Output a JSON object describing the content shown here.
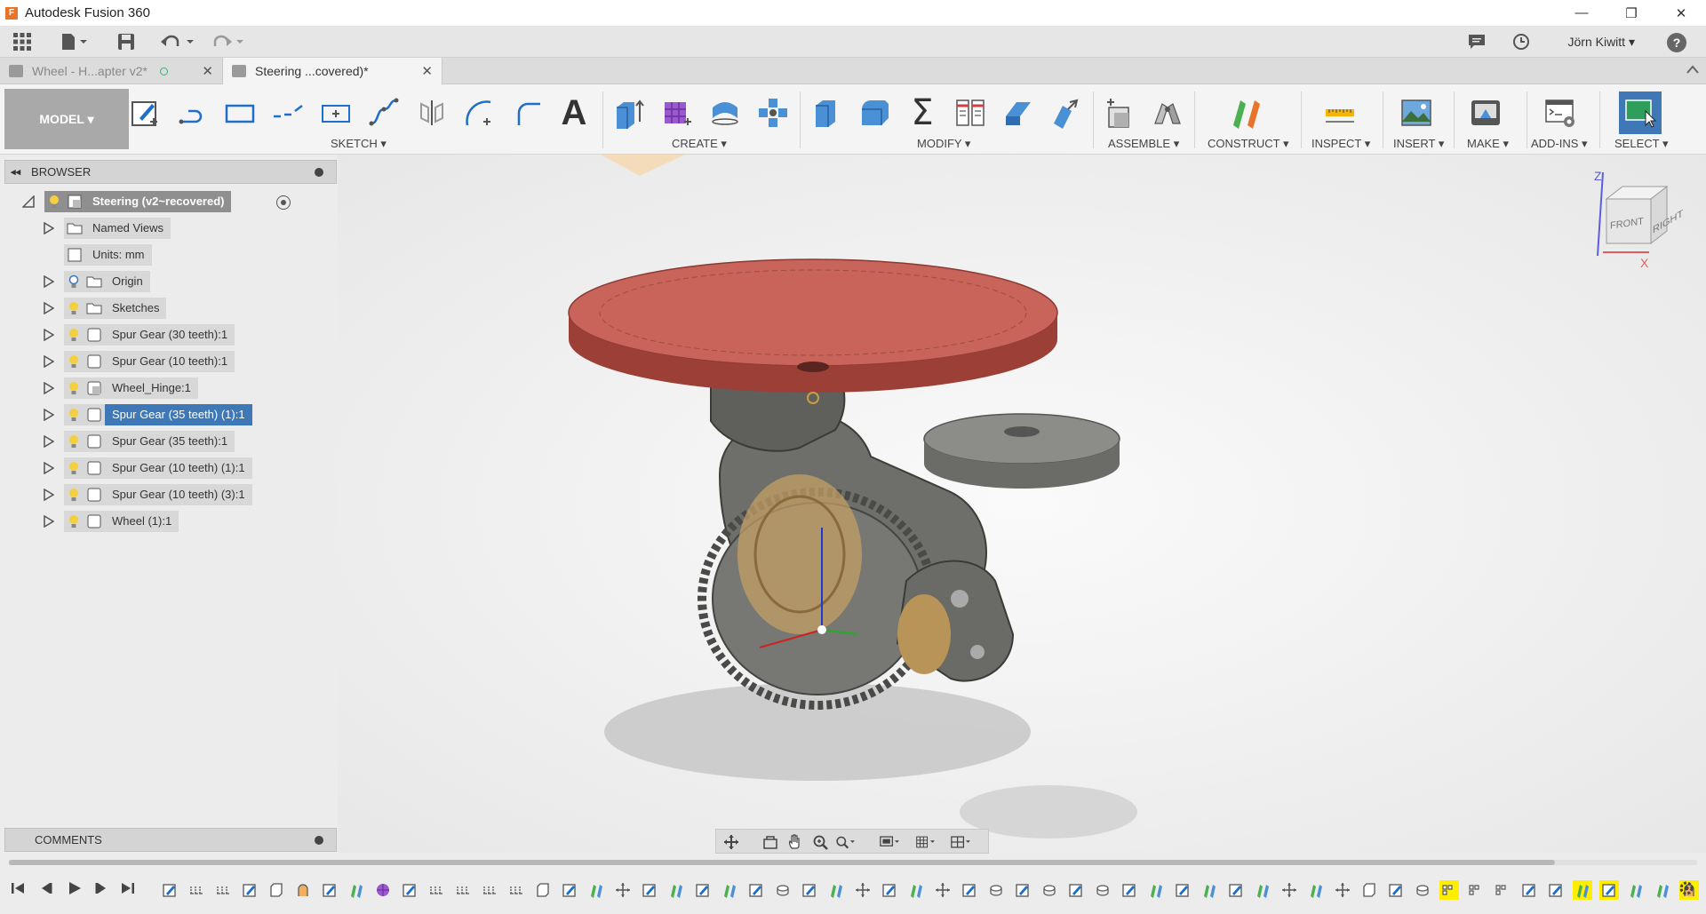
{
  "window": {
    "title": "Autodesk Fusion 360",
    "min_glyph": "—",
    "max_glyph": "❐",
    "close_glyph": "✕"
  },
  "quick_access": {
    "user": "Jörn Kiwitt ▾",
    "help": "?"
  },
  "tabs": [
    {
      "label": "Wheel - H...apter v2*",
      "close": "✕"
    },
    {
      "label": "Steering ...covered)*",
      "close": "✕"
    }
  ],
  "ribbon": {
    "workspace": "MODEL ▾",
    "groups": {
      "sketch": "SKETCH ▾",
      "create": "CREATE ▾",
      "modify": "MODIFY ▾",
      "assemble": "ASSEMBLE ▾",
      "construct": "CONSTRUCT ▾",
      "inspect": "INSPECT ▾",
      "insert": "INSERT ▾",
      "make": "MAKE ▾",
      "addins": "ADD-INS ▾",
      "select": "SELECT ▾"
    },
    "text_tool_glyph": "A",
    "sum_glyph": "Σ"
  },
  "browser": {
    "title": "BROWSER",
    "collapse_glyph": "◂◂",
    "root": "Steering (v2~recovered)",
    "items": [
      "Named Views",
      "Units: mm",
      "Origin",
      "Sketches",
      "Spur Gear (30 teeth):1",
      "Spur Gear (10 teeth):1",
      "Wheel_Hinge:1",
      "Spur Gear (35 teeth) (1):1",
      "Spur Gear (35 teeth):1",
      "Spur Gear (10 teeth) (1):1",
      "Spur Gear (10 teeth) (3):1",
      "Wheel (1):1"
    ]
  },
  "comments": {
    "title": "COMMENTS"
  },
  "viewcube": {
    "front": "FRONT",
    "right": "RIGHT",
    "z": "Z",
    "x": "X"
  },
  "colors": {
    "accent": "#3f78b6",
    "gear_top": "#c8645a",
    "gear_grey": "#8c8c88",
    "highlight": "#ffee00"
  }
}
